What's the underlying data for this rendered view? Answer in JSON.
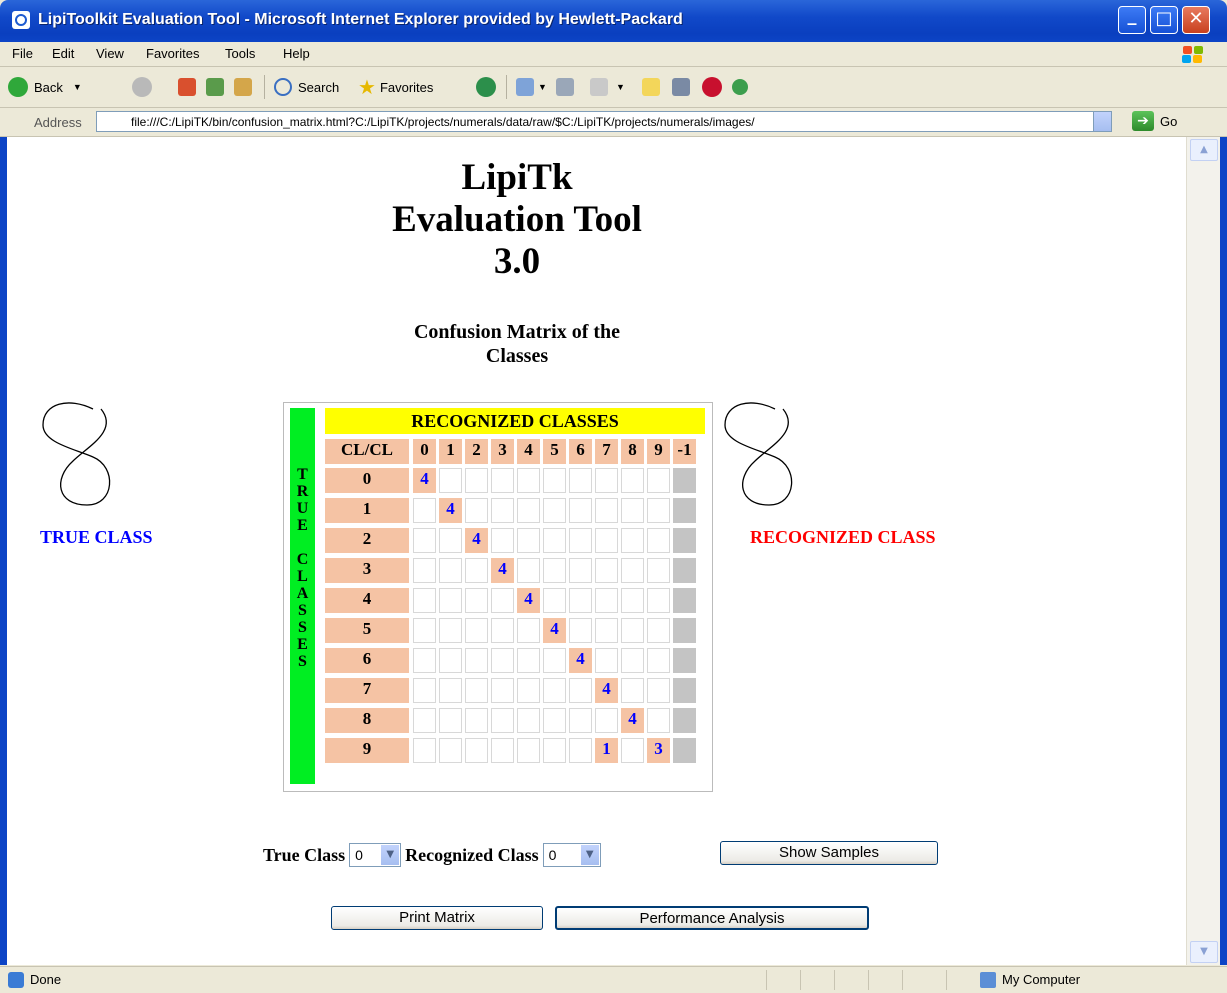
{
  "window": {
    "title": "LipiToolkit Evaluation Tool - Microsoft Internet Explorer provided by Hewlett-Packard"
  },
  "menu": [
    "File",
    "Edit",
    "View",
    "Favorites",
    "Tools",
    "Help"
  ],
  "toolbar": {
    "back_label": "Back",
    "search_label": "Search",
    "favorites_label": "Favorites"
  },
  "address": {
    "label": "Address",
    "url": "file:///C:/LipiTK/bin/confusion_matrix.html?C:/LipiTK/projects/numerals/data/raw/$C:/LipiTK/projects/numerals/images/",
    "go_label": "Go"
  },
  "page": {
    "title_line1": "LipiTk",
    "title_line2": "Evaluation Tool",
    "title_line3": "3.0",
    "subtitle_line1": "Confusion Matrix of the",
    "subtitle_line2": "Classes",
    "true_class_label": "TRUE CLASS",
    "recognized_class_label": "RECOGNIZED CLASS",
    "true_sample_glyph": "8",
    "recognized_sample_glyph": "8"
  },
  "matrix": {
    "recognized_header": "RECOGNIZED CLASSES",
    "true_vertical": [
      "T",
      "R",
      "U",
      "E",
      "",
      "C",
      "L",
      "A",
      "S",
      "S",
      "E",
      "S"
    ],
    "corner_label": "CL/CL",
    "column_headers": [
      "0",
      "1",
      "2",
      "3",
      "4",
      "5",
      "6",
      "7",
      "8",
      "9",
      "-1"
    ],
    "row_headers": [
      "0",
      "1",
      "2",
      "3",
      "4",
      "5",
      "6",
      "7",
      "8",
      "9"
    ],
    "cells": [
      [
        "4",
        "",
        "",
        "",
        "",
        "",
        "",
        "",
        "",
        "",
        ""
      ],
      [
        "",
        "4",
        "",
        "",
        "",
        "",
        "",
        "",
        "",
        "",
        ""
      ],
      [
        "",
        "",
        "4",
        "",
        "",
        "",
        "",
        "",
        "",
        "",
        ""
      ],
      [
        "",
        "",
        "",
        "4",
        "",
        "",
        "",
        "",
        "",
        "",
        ""
      ],
      [
        "",
        "",
        "",
        "",
        "4",
        "",
        "",
        "",
        "",
        "",
        ""
      ],
      [
        "",
        "",
        "",
        "",
        "",
        "4",
        "",
        "",
        "",
        "",
        ""
      ],
      [
        "",
        "",
        "",
        "",
        "",
        "",
        "4",
        "",
        "",
        "",
        ""
      ],
      [
        "",
        "",
        "",
        "",
        "",
        "",
        "",
        "4",
        "",
        "",
        ""
      ],
      [
        "",
        "",
        "",
        "",
        "",
        "",
        "",
        "",
        "4",
        "",
        ""
      ],
      [
        "",
        "",
        "",
        "",
        "",
        "",
        "",
        "1",
        "",
        "3",
        ""
      ]
    ]
  },
  "controls": {
    "true_class_label": "True Class",
    "true_class_value": "0",
    "recognized_class_label": "Recognized Class",
    "recognized_class_value": "0",
    "show_samples": "Show Samples",
    "print_matrix": "Print Matrix",
    "performance_analysis": "Performance Analysis"
  },
  "status": {
    "left": "Done",
    "zone": "My Computer"
  },
  "colors": {
    "true_class": "#0000ff",
    "recognized_class": "#ff0000",
    "header_yellow": "#ffff00",
    "true_bar_green": "#00ee22",
    "label_peach": "#f5c3a4",
    "reject_gray": "#c4c4c4"
  }
}
